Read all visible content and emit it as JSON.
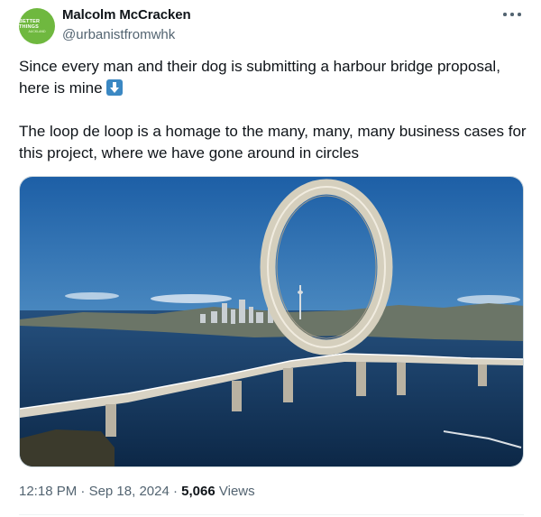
{
  "author": {
    "name": "Malcolm McCracken",
    "handle": "@urbanistfromwhk",
    "avatar_text": "BETTER THINGS",
    "avatar_subtext": "AUCKLAND"
  },
  "tweet": {
    "line1": "Since every man and their dog is submitting a harbour bridge proposal, here is mine",
    "emoji": "down-arrow-emoji",
    "line2": "The loop de loop is a homage to the many, many, many business cases for this project, where we have gone around in circles"
  },
  "meta": {
    "time": "12:18 PM",
    "date": "Sep 18, 2024",
    "views_count": "5,066",
    "views_label": "Views",
    "separator": "·"
  },
  "colors": {
    "text": "#0f1419",
    "secondary": "#536471",
    "emoji_blue": "#3b88c3"
  }
}
